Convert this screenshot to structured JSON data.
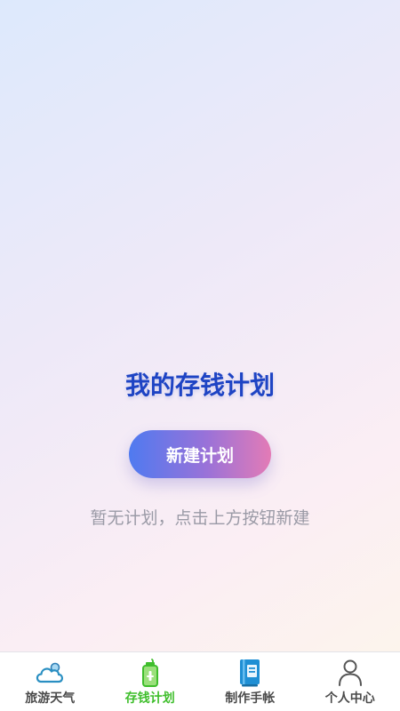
{
  "main": {
    "title": "我的存钱计划",
    "new_plan_button": "新建计划",
    "empty_hint": "暂无计划，点击上方按钮新建"
  },
  "tabbar": {
    "active_index": 1,
    "active_color": "#3fbe2c",
    "items": [
      {
        "label": "旅游天气",
        "icon": "cloud-icon"
      },
      {
        "label": "存钱计划",
        "icon": "piggy-bank-icon"
      },
      {
        "label": "制作手帐",
        "icon": "notebook-icon"
      },
      {
        "label": "个人中心",
        "icon": "user-icon"
      }
    ]
  },
  "colors": {
    "title": "#1e44c4",
    "button_gradient_start": "#4f7af0",
    "button_gradient_end": "#e37bb6",
    "hint": "#9a9aa6"
  }
}
